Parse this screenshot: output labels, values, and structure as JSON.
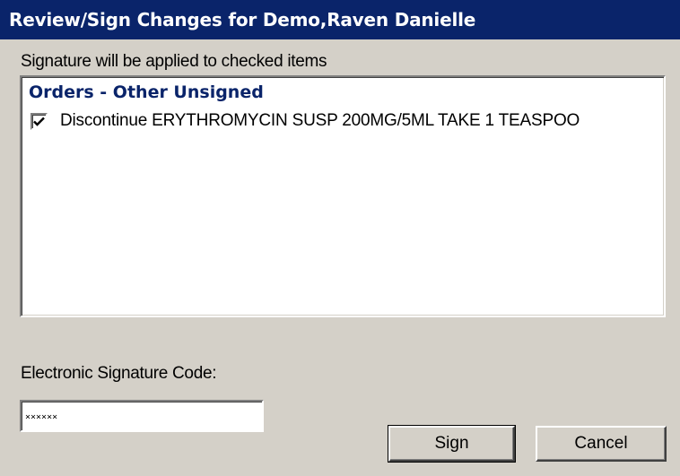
{
  "window": {
    "title": "Review/Sign Changes for Demo,Raven Danielle"
  },
  "instruction": "Signature will be applied to checked items",
  "orders_group": {
    "header": "Orders - Other Unsigned",
    "items": [
      {
        "checked": true,
        "text": "Discontinue ERYTHROMYCIN SUSP  200MG/5ML TAKE 1 TEASPOO"
      }
    ]
  },
  "signature": {
    "label": "Electronic Signature Code:",
    "value": "××××××"
  },
  "buttons": {
    "sign": "Sign",
    "cancel": "Cancel"
  },
  "colors": {
    "titlebar": "#0a246a",
    "group_header": "#0a246a",
    "dialog_bg": "#d4d0c8"
  }
}
